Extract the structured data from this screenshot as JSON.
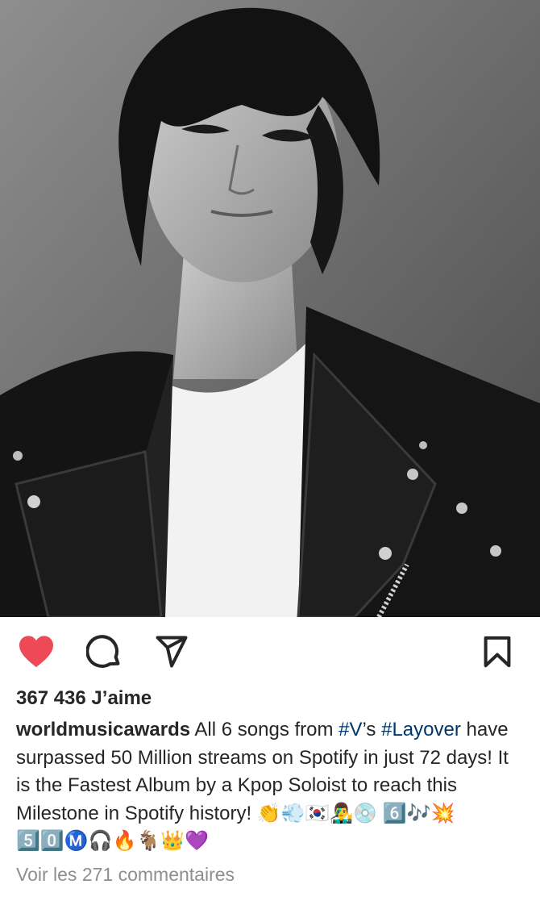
{
  "post": {
    "image_alt": "Black and white portrait of a man in a leather jacket and white t-shirt"
  },
  "actions": {
    "like_icon": "heart-icon",
    "comment_icon": "comment-bubble-icon",
    "share_icon": "paper-plane-icon",
    "save_icon": "bookmark-icon",
    "liked": true,
    "like_color": "#ed4956"
  },
  "likes": {
    "text": "367 436 J’aime"
  },
  "caption": {
    "username": "worldmusicawards",
    "text_1": " All 6 songs from ",
    "hashtag_1": "#V",
    "text_2": "’s ",
    "hashtag_2": "#Layover",
    "text_3": " have surpassed 50 Million streams on Spotify in just 72 days! It is the Fastest Album by a Kpop Soloist to reach this Milestone in Spotify history! 👏💨🇰🇷👨‍🎤💿 6️⃣🎶💥5️⃣0️⃣Ⓜ️🎧🔥🐐👑💜",
    "hashtag_color": "#00376b"
  },
  "comments": {
    "link_text": "Voir les 271 commentaires"
  }
}
